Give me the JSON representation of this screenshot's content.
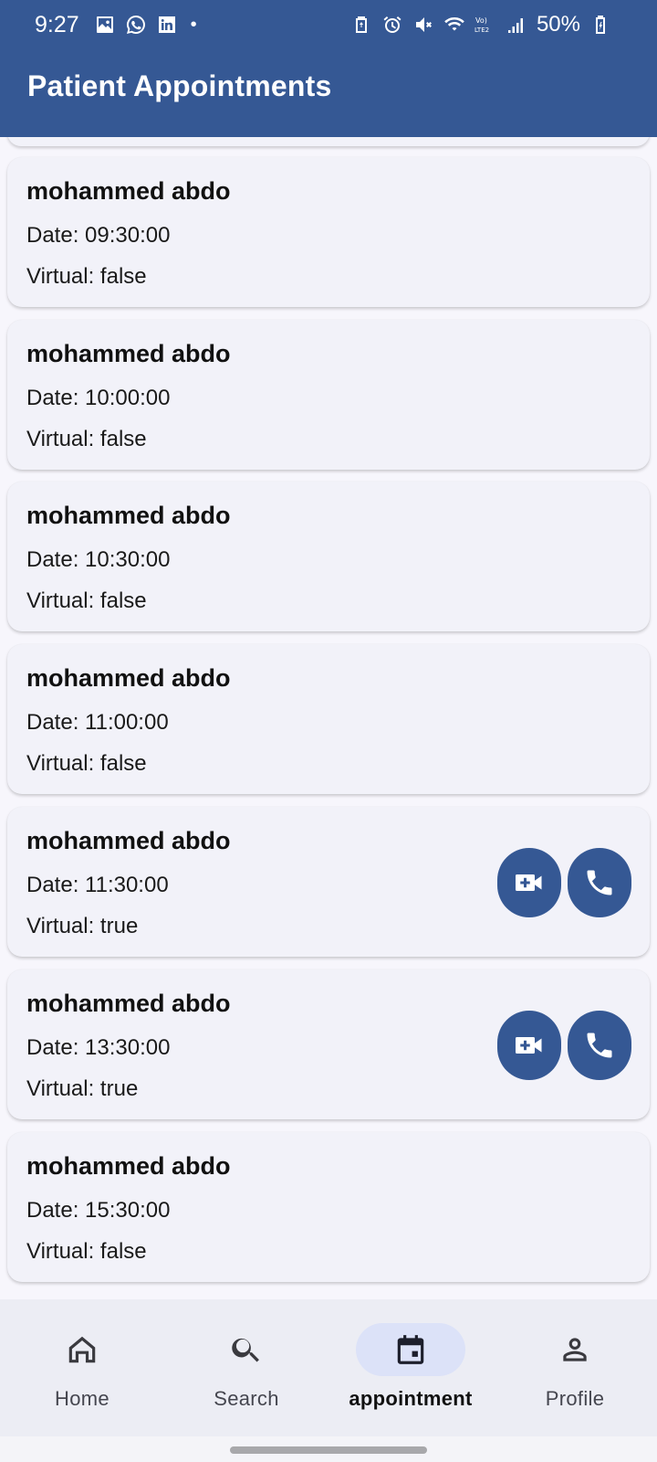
{
  "status_bar": {
    "time": "9:27",
    "battery": "50%",
    "left_icons": [
      "gallery-icon",
      "whatsapp-icon",
      "linkedin-icon"
    ],
    "right_icons": [
      "battery-saver-icon",
      "alarm-icon",
      "mute-icon",
      "wifi-icon",
      "volte-icon",
      "signal-icon",
      "battery-icon"
    ]
  },
  "app_bar": {
    "title": "Patient Appointments",
    "color": "#355894"
  },
  "appointments": [
    {
      "name": "mohammed abdo",
      "date": "Date: 09:30:00",
      "virtual": "Virtual: false"
    },
    {
      "name": "mohammed abdo",
      "date": "Date: 10:00:00",
      "virtual": "Virtual: false"
    },
    {
      "name": "mohammed abdo",
      "date": "Date: 10:30:00",
      "virtual": "Virtual: false"
    },
    {
      "name": "mohammed abdo",
      "date": "Date: 11:00:00",
      "virtual": "Virtual: false"
    },
    {
      "name": "mohammed abdo",
      "date": "Date: 11:30:00",
      "virtual": "Virtual: true",
      "actions": [
        "video-call-icon",
        "phone-icon"
      ]
    },
    {
      "name": "mohammed abdo",
      "date": "Date: 13:30:00",
      "virtual": "Virtual: true",
      "actions": [
        "video-call-icon",
        "phone-icon"
      ]
    },
    {
      "name": "mohammed abdo",
      "date": "Date: 15:30:00",
      "virtual": "Virtual: false"
    }
  ],
  "bottom_nav": {
    "items": [
      {
        "label": "Home",
        "icon": "home-icon"
      },
      {
        "label": "Search",
        "icon": "search-icon"
      },
      {
        "label": "appointment",
        "icon": "calendar-icon",
        "active": true
      },
      {
        "label": "Profile",
        "icon": "person-icon"
      }
    ]
  }
}
